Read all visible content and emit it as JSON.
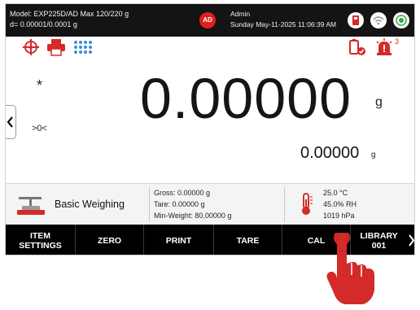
{
  "header": {
    "model_line": "Model: EXP225D/AD   Max 120/220 g",
    "division_line": "d= 0.00001/0.0001 g",
    "user_initials": "AD",
    "user_name": "Admin",
    "datetime": "Sunday May-11-2025 11:06:39 AM",
    "status_icons": [
      "usb-storage-icon",
      "wifi-icon",
      "level-bubble-icon"
    ]
  },
  "toolbar": {
    "icons": [
      "target-icon",
      "printer-icon",
      "keypad-icon",
      "battery-check-icon",
      "alarm-icon"
    ],
    "alarm_count": "3"
  },
  "reading": {
    "stable_mark": "*",
    "zero_mark": ">0<",
    "main_value": "0.00000",
    "main_unit": "g",
    "secondary_value": "0.00000",
    "secondary_unit": "g"
  },
  "info": {
    "application": "Basic Weighing",
    "gross": "Gross: 0.00000 g",
    "tare": "Tare: 0.00000 g",
    "min_weight": "Min-Weight: 80.00000 g",
    "temperature": "25.0 °C",
    "humidity": "45.0% RH",
    "pressure": "1019 hPa"
  },
  "functions": [
    {
      "label": "ITEM\nSETTINGS"
    },
    {
      "label": "ZERO"
    },
    {
      "label": "PRINT"
    },
    {
      "label": "TARE"
    },
    {
      "label": "CAL"
    },
    {
      "label": "LIBRARY\n001"
    }
  ],
  "colors": {
    "accent_red": "#d42a2a",
    "bar_black": "#000000",
    "keypad_blue": "#3a8fd8"
  }
}
